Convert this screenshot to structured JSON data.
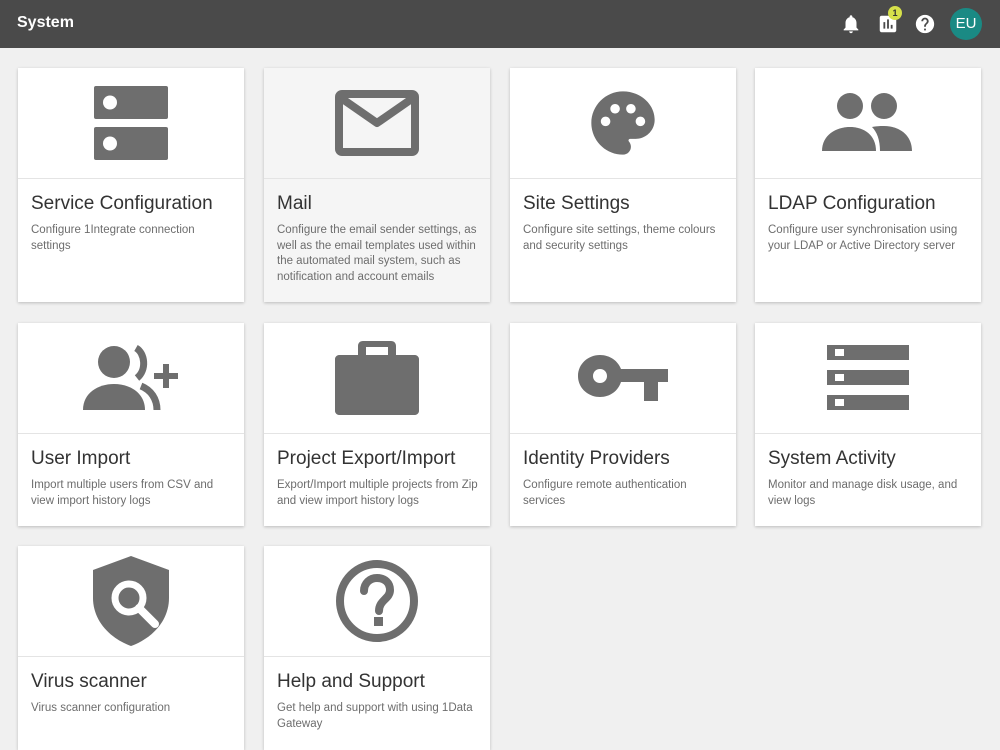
{
  "header": {
    "title": "System",
    "notification_badge": "1",
    "avatar_initials": "EU",
    "bar_color": "#4a4a4a",
    "avatar_color": "#1a8a84",
    "badge_color": "#d6e04a"
  },
  "cards": [
    {
      "icon": "server-icon",
      "title": "Service Configuration",
      "description": "Configure 1Integrate connection settings"
    },
    {
      "icon": "mail-icon",
      "title": "Mail",
      "description": "Configure the email sender settings, as well as the email templates used within the automated mail system, such as notification and account emails"
    },
    {
      "icon": "palette-icon",
      "title": "Site Settings",
      "description": "Configure site settings, theme colours and security settings"
    },
    {
      "icon": "people-icon",
      "title": "LDAP Configuration",
      "description": "Configure user synchronisation using your LDAP or Active Directory server"
    },
    {
      "icon": "group-add-icon",
      "title": "User Import",
      "description": "Import multiple users from CSV and view import history logs"
    },
    {
      "icon": "briefcase-icon",
      "title": "Project Export/Import",
      "description": "Export/Import multiple projects from Zip and view import history logs"
    },
    {
      "icon": "key-icon",
      "title": "Identity Providers",
      "description": "Configure remote authentication services"
    },
    {
      "icon": "list-icon",
      "title": "System Activity",
      "description": "Monitor and manage disk usage, and view logs"
    },
    {
      "icon": "shield-search-icon",
      "title": "Virus scanner",
      "description": "Virus scanner configuration"
    },
    {
      "icon": "help-circle-icon",
      "title": "Help and Support",
      "description": "Get help and support with using 1Data Gateway"
    }
  ]
}
